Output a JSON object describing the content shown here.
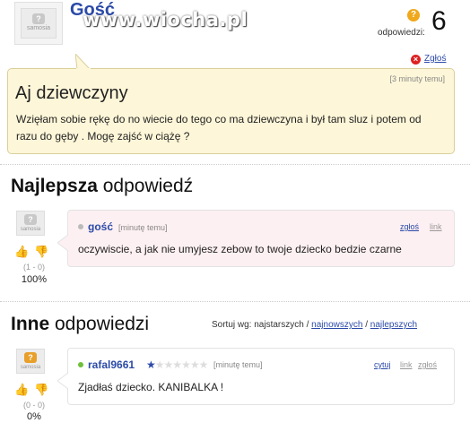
{
  "question": {
    "author": "Gość",
    "watermark": "www.wiocha.pl",
    "answers_label": "odpowiedzi:",
    "answers_count": "6",
    "report_label": "Zgłoś",
    "time": "[3 minuty temu]",
    "title": "Aj dziewczyny",
    "body": "Wzięłam sobie rękę do no wiecie do tego co ma dziewczyna i był tam sluz i potem od razu do gęby . Mogę zajść w ciążę ?"
  },
  "best": {
    "title_bold": "Najlepsza",
    "title_rest": " odpowiedź",
    "author": "gość",
    "time": "[minutę temu]",
    "report": "zgłoś",
    "link": "link",
    "text": "oczywiscie, a jak nie umyjesz zebow to twoje dziecko bedzie czarne",
    "votes": "(1 - 0)",
    "percent": "100%"
  },
  "others": {
    "title_bold": "Inne",
    "title_rest": " odpowiedzi",
    "sort_label": "Sortuj wg: najstarszych / ",
    "sort_newest": "najnowszych",
    "sort_sep": " / ",
    "sort_best": "najlepszych",
    "items": [
      {
        "author": "rafal9661",
        "time": "[minutę temu]",
        "quote": "cytuj",
        "link": "link",
        "report": "zgłoś",
        "text": "Zjadłaś dziecko. KANIBALKA !",
        "votes": "(0 - 0)",
        "percent": "0%",
        "rating": 1,
        "rating_max": 7
      }
    ]
  },
  "icons": {
    "avatar_text": "samosia",
    "question_mark": "?",
    "thumb_up": "👍",
    "thumb_down": "👎",
    "report_x": "×",
    "star": "★"
  },
  "colors": {
    "link_blue": "#2b4aa8",
    "question_bg": "#fdf6d8",
    "best_bg": "#fdf0f2",
    "accent_orange": "#f0a81c",
    "online_green": "#6fbf3b"
  }
}
